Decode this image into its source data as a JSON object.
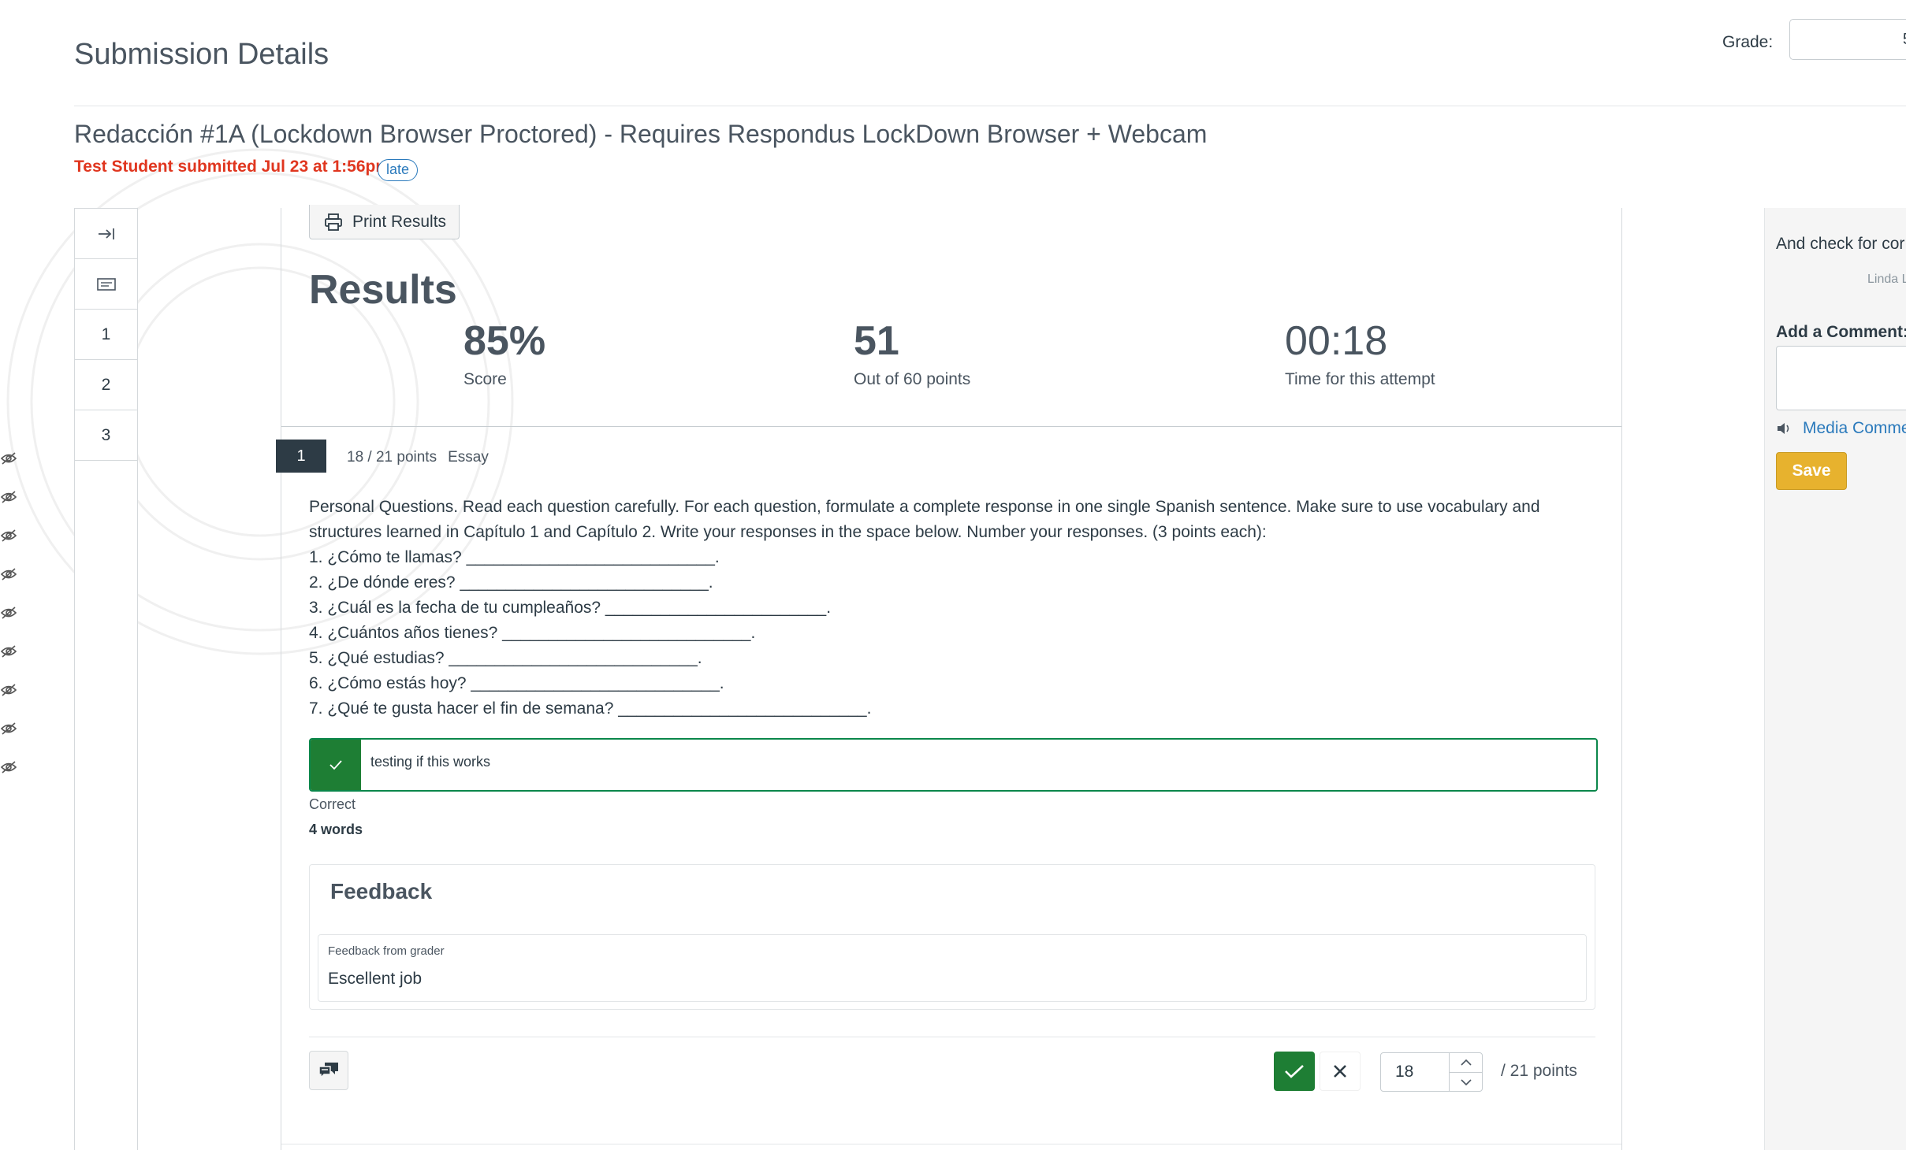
{
  "header": {
    "title": "Submission Details",
    "grade_label": "Grade:",
    "grade_value": "5"
  },
  "assignment": {
    "title": "Redacción #1A (Lockdown Browser Proctored) - Requires Respondus LockDown Browser + Webcam",
    "submitted_text": "Test Student submitted Jul 23 at 1:56pm",
    "late_badge": "late"
  },
  "question_nav": {
    "items": [
      "1",
      "2",
      "3"
    ]
  },
  "results": {
    "print_label": "Print Results",
    "heading": "Results",
    "score_value": "85%",
    "score_label": "Score",
    "points_value": "51",
    "points_label": "Out of 60 points",
    "time_value": "00:18",
    "time_label": "Time for this attempt"
  },
  "question": {
    "number": "1",
    "points": "18 / 21 points",
    "type": "Essay",
    "prompt_line1": "Personal Questions. Read each question carefully. For each question, formulate a complete response in one single Spanish sentence. Make sure to use vocabulary and",
    "prompt_line2": "structures learned in Capítulo 1 and Capítulo 2. Write your responses in the space below. Number your responses. (3 points each):",
    "items": [
      "1. ¿Cómo te llamas? ___________________________.",
      "2. ¿De dónde eres? ___________________________.",
      "3. ¿Cuál es la fecha de tu cumpleaños? ________________________.",
      "4. ¿Cuántos años tienes? ___________________________.",
      "5. ¿Qué estudias? ___________________________.",
      "6. ¿Cómo estás hoy? ___________________________.",
      "7. ¿Qué te gusta hacer el fin de semana? ___________________________."
    ],
    "answer": "testing if this works",
    "status": "Correct",
    "word_count": "4 words",
    "feedback_heading": "Feedback",
    "feedback_from": "Feedback from grader",
    "feedback_text": "Escellent job",
    "score_input": "18",
    "score_total": "/ 21 points"
  },
  "right_panel": {
    "comment_text": "And check for cor",
    "comment_author": "Linda L",
    "add_comment_label": "Add a Comment:",
    "media_comment_label": "Media Comme",
    "save_label": "Save"
  },
  "colors": {
    "accent_red": "#e0361f",
    "link_blue": "#2b7abc",
    "correct_green": "#1e7e34",
    "save_yellow": "#e7b22e",
    "nav_dark": "#2d3b45"
  }
}
